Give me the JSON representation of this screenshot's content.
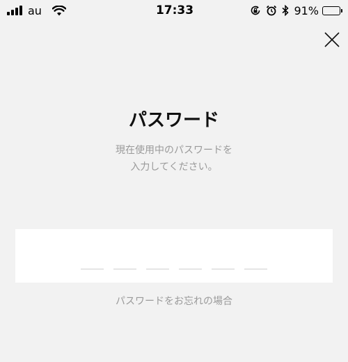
{
  "status_bar": {
    "carrier": "au",
    "time": "17:33",
    "battery_text": "91%",
    "battery_level": 0.91,
    "icons": [
      "signal-icon",
      "wifi-icon",
      "rotation-lock-icon",
      "alarm-icon",
      "bluetooth-icon",
      "battery-icon"
    ]
  },
  "screen": {
    "title": "パスワード",
    "description_line1": "現在使用中のパスワードを",
    "description_line2": "入力してください。",
    "pin_length": 6,
    "forgot_link": "パスワードをお忘れの場合",
    "close_icon": "close-icon"
  },
  "colors": {
    "background": "#f2f2f2",
    "input_background": "#ffffff",
    "muted_text": "#9a9a9a",
    "pin_underline": "#cfcfcf"
  }
}
